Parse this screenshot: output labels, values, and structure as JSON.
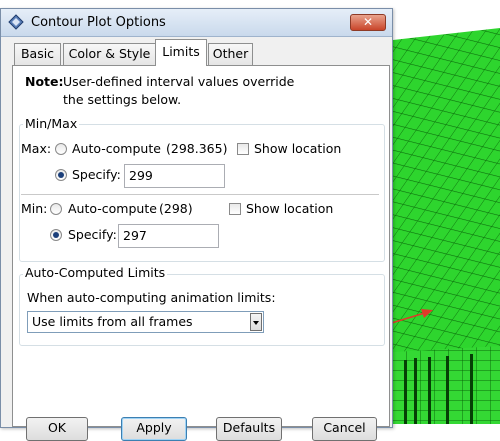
{
  "window": {
    "title": "Contour Plot Options",
    "close_symbol": "✕"
  },
  "tabs": [
    {
      "label": "Basic",
      "active": false
    },
    {
      "label": "Color & Style",
      "active": false
    },
    {
      "label": "Limits",
      "active": true
    },
    {
      "label": "Other",
      "active": false
    }
  ],
  "note": {
    "label": "Note:",
    "line1": "User-defined interval values override",
    "line2": "the settings below."
  },
  "minmax": {
    "group_title": "Min/Max",
    "max": {
      "label": "Max:",
      "auto_label": "Auto-compute",
      "auto_value": "(298.365)",
      "show_location": "Show location",
      "specify_label": "Specify:",
      "specify_value": "299",
      "mode": "specify"
    },
    "min": {
      "label": "Min:",
      "auto_label": "Auto-compute",
      "auto_value": "(298)",
      "show_location": "Show location",
      "specify_label": "Specify:",
      "specify_value": "297",
      "mode": "specify"
    }
  },
  "auto_limits": {
    "group_title": "Auto-Computed Limits",
    "label": "When auto-computing animation limits:",
    "selected": "Use limits from all frames"
  },
  "buttons": {
    "ok": "OK",
    "apply": "Apply",
    "defaults": "Defaults",
    "cancel": "Cancel"
  },
  "colors": {
    "mesh_green": "#2ed52e",
    "accent_blue": "#1c3f7a",
    "arrow_red": "#e03a2a"
  }
}
